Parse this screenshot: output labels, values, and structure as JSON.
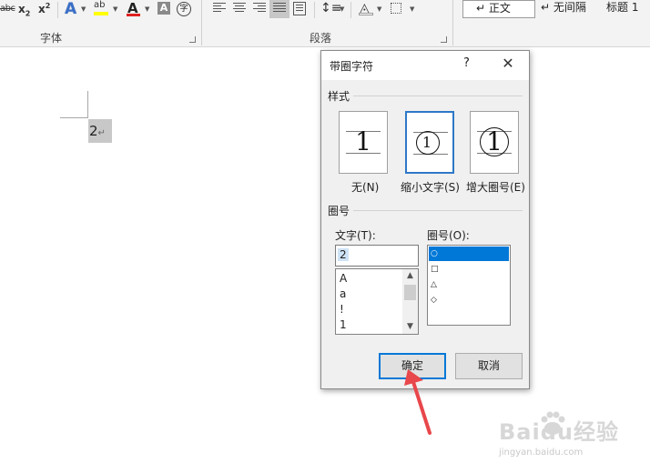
{
  "ribbon": {
    "font_tools": {
      "strikethrough_label": "abc",
      "subscript_base": "x",
      "subscript_mark": "2",
      "superscript_base": "x",
      "superscript_mark": "2",
      "text_effect_label": "A",
      "highlight_label": "ab",
      "highlight_color": "#ffff00",
      "font_color_label": "A",
      "font_color": "#e02020",
      "char_shading_label": "A",
      "enclose_label": "字"
    },
    "font_group_label": "字体",
    "paragraph_group_label": "段落",
    "styles": [
      "↵ 正文",
      "↵ 无间隔",
      "标题 1"
    ]
  },
  "document": {
    "enclosed_char": "2",
    "paragraph_mark": "↵"
  },
  "dialog": {
    "title": "带圈字符",
    "help_label": "?",
    "close_label": "✕",
    "style_group_label": "样式",
    "style_options": [
      {
        "glyph": "1",
        "caption": "无(N)",
        "selected": false
      },
      {
        "glyph": "1",
        "caption": "缩小文字(S)",
        "selected": true
      },
      {
        "glyph": "1",
        "caption": "增大圈号(E)",
        "selected": false
      }
    ],
    "enclosure_group_label": "圈号",
    "text_label": "文字(T):",
    "text_value": "2",
    "text_list": [
      "A",
      "a",
      "!",
      "1"
    ],
    "enclosure_label": "圈号(O):",
    "enclosure_list": [
      "○",
      "□",
      "△",
      "◇"
    ],
    "ok_label": "确定",
    "cancel_label": "取消",
    "accent": "#0078d7"
  },
  "annotation": {
    "arrow_color": "#e8474b"
  },
  "watermark": {
    "brand": "Baidu经验",
    "url": "jingyan.baidu.com"
  }
}
